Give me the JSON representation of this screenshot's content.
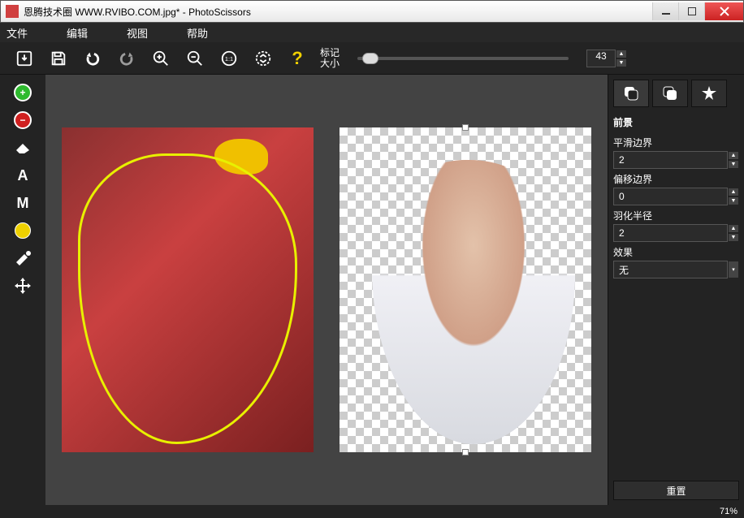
{
  "window": {
    "title": "恩腾技术圈 WWW.RVIBO.COM.jpg* - PhotoScissors"
  },
  "menubar": {
    "file": "文件",
    "edit": "编辑",
    "view": "视图",
    "help": "帮助"
  },
  "toolbar": {
    "mark_label_line1": "标记",
    "mark_label_line2": "大小",
    "mark_size": "43"
  },
  "right": {
    "section": "前景",
    "smooth_label": "平滑边界",
    "smooth_value": "2",
    "offset_label": "偏移边界",
    "offset_value": "0",
    "feather_label": "羽化半径",
    "feather_value": "2",
    "effect_label": "效果",
    "effect_value": "无",
    "reset": "重置"
  },
  "status": {
    "zoom": "71%"
  }
}
